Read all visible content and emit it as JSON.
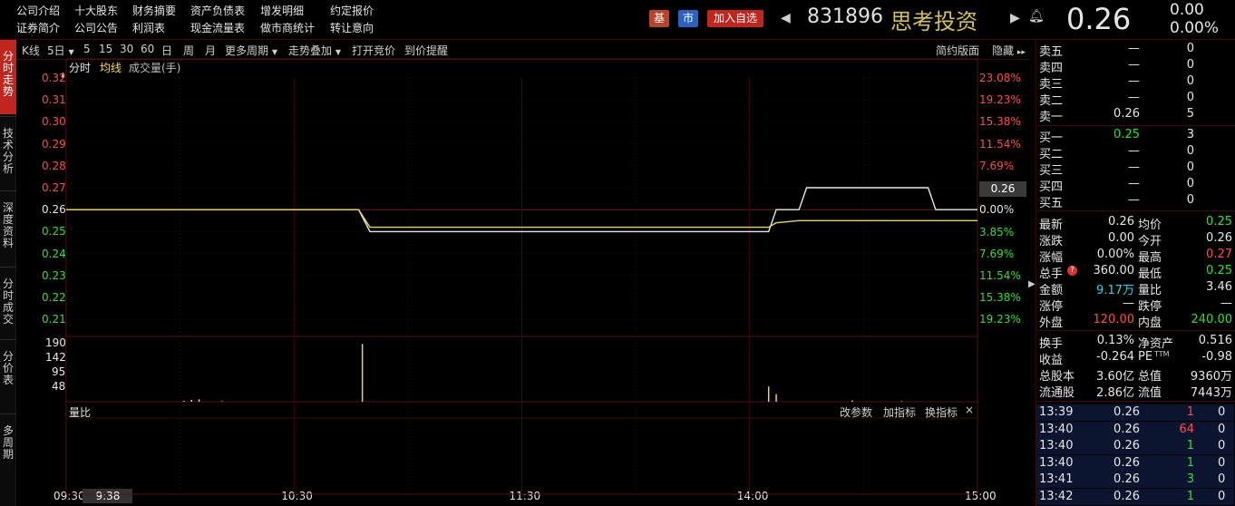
{
  "top_nav": {
    "row1": [
      "公司介绍",
      "十大股东",
      "财务摘要",
      "资产负债表",
      "增发明细",
      "约定报价"
    ],
    "row2": [
      "证券简介",
      "公司公告",
      "利润表",
      "现金流量表",
      "做市商统计",
      "转让意向"
    ]
  },
  "stock": {
    "badge_ji": "基",
    "badge_shi": "市",
    "add_watchlist": "加入自选",
    "code": "831896",
    "name": "思考投资",
    "price": "0.26",
    "change": "0.00",
    "change_pct": "0.00%"
  },
  "left_tabs": [
    "分时走势",
    "技术分析",
    "深度资料",
    "分时成交",
    "分价表",
    "多周期"
  ],
  "toolbar": {
    "kline": "K线",
    "period": "5日",
    "periods": [
      "5",
      "15",
      "30",
      "60",
      "日",
      "周",
      "月"
    ],
    "more_period": "更多周期",
    "overlay": "走势叠加",
    "auction": "打开竞价",
    "alert": "到价提醒",
    "simple": "简约版面",
    "hide": "隐藏"
  },
  "chart_legend": {
    "label1": "分时",
    "label2": "均线",
    "label3": "成交量(手)"
  },
  "chart_data": {
    "type": "line",
    "y_ticks_price": [
      "0.32",
      "0.31",
      "0.30",
      "0.29",
      "0.28",
      "0.27",
      "0.26",
      "0.25",
      "0.24",
      "0.23",
      "0.22",
      "0.21"
    ],
    "y_ticks_pct": [
      "23.08%",
      "19.23%",
      "15.38%",
      "11.54%",
      "7.69%",
      "0.00%",
      "3.85%",
      "7.69%",
      "11.54%",
      "15.38%",
      "19.23%"
    ],
    "price_current_label": "0.26",
    "x_ticks": [
      "09:30",
      "9:38",
      "10:30",
      "11:30",
      "14:00",
      "15:00"
    ],
    "ylim": [
      0.205,
      0.325
    ],
    "series": [
      {
        "values": [
          [
            0,
            0.26
          ],
          [
            77,
            0.26
          ],
          [
            80,
            0.25
          ],
          [
            185,
            0.25
          ],
          [
            187,
            0.26
          ],
          [
            193,
            0.26
          ],
          [
            195,
            0.27
          ],
          [
            227,
            0.27
          ],
          [
            229,
            0.26
          ],
          [
            240,
            0.26
          ]
        ]
      },
      {
        "values": [
          [
            0,
            0.26
          ],
          [
            77,
            0.26
          ],
          [
            80,
            0.252
          ],
          [
            185,
            0.252
          ],
          [
            187,
            0.254
          ],
          [
            193,
            0.255
          ],
          [
            240,
            0.255
          ]
        ]
      }
    ],
    "volume_ticks": [
      "190",
      "142",
      "95",
      "48"
    ],
    "volume_ylim": [
      0,
      200
    ],
    "volume_bars": [
      [
        31,
        3
      ],
      [
        33,
        6
      ],
      [
        35,
        8
      ],
      [
        41,
        2
      ],
      [
        78,
        190
      ],
      [
        185,
        50
      ],
      [
        187,
        25
      ],
      [
        207,
        4
      ],
      [
        220,
        2
      ]
    ]
  },
  "indicator_panel": {
    "title": "量比",
    "btn1": "改参数",
    "btn2": "加指标",
    "btn3": "换指标",
    "close": "×"
  },
  "order_book": {
    "sell": [
      [
        "卖五",
        "—",
        "0"
      ],
      [
        "卖四",
        "—",
        "0"
      ],
      [
        "卖三",
        "—",
        "0"
      ],
      [
        "卖二",
        "—",
        "0"
      ],
      [
        "卖一",
        "0.26",
        "5"
      ]
    ],
    "buy": [
      [
        "买一",
        "0.25",
        "3"
      ],
      [
        "买二",
        "—",
        "0"
      ],
      [
        "买三",
        "—",
        "0"
      ],
      [
        "买四",
        "—",
        "0"
      ],
      [
        "买五",
        "—",
        "0"
      ]
    ]
  },
  "stats": [
    [
      "最新",
      "0.26",
      "均价",
      "0.25"
    ],
    [
      "涨跌",
      "0.00",
      "今开",
      "0.26"
    ],
    [
      "涨幅",
      "0.00%",
      "最高",
      "0.27"
    ],
    [
      "总手",
      "360.00",
      "最低",
      "0.25"
    ],
    [
      "金额",
      "9.17万",
      "量比",
      "3.46"
    ],
    [
      "涨停",
      "—",
      "跌停",
      "—"
    ],
    [
      "外盘",
      "120.00",
      "内盘",
      "240.00"
    ]
  ],
  "fund": [
    [
      "换手",
      "0.13%",
      "净资产",
      "0.516"
    ],
    [
      "收益",
      "-0.264",
      "PE",
      "-0.98"
    ],
    [
      "总股本",
      "3.60亿",
      "总值",
      "9360万"
    ],
    [
      "流通股",
      "2.86亿",
      "流值",
      "7443万"
    ]
  ],
  "pe_sup": "TTM",
  "ticks": [
    [
      "13:39",
      "0.26",
      "1"
    ],
    [
      "13:40",
      "0.26",
      "64"
    ],
    [
      "13:40",
      "0.26",
      "1"
    ],
    [
      "13:40",
      "0.26",
      "1"
    ],
    [
      "13:41",
      "0.26",
      "3"
    ],
    [
      "13:42",
      "0.26",
      "1"
    ]
  ]
}
